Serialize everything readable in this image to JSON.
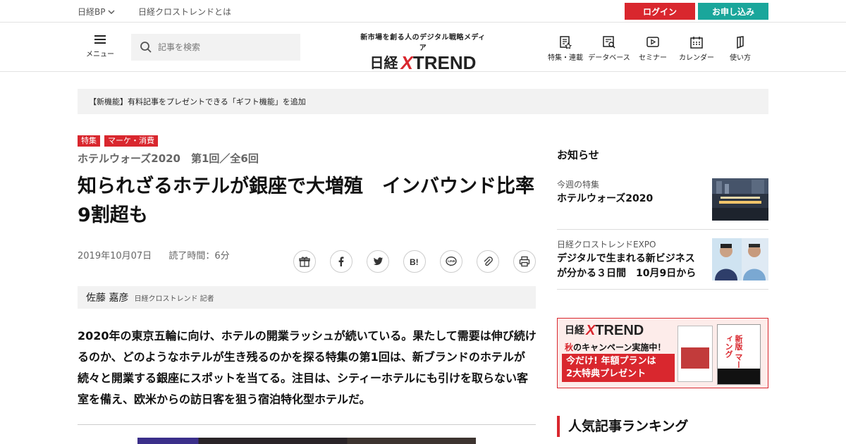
{
  "topbar": {
    "nikkei_bp": "日経BP",
    "about": "日経クロストレンドとは",
    "login": "ログイン",
    "apply": "お申し込み",
    "login_color": "#d9272e",
    "apply_color": "#1aa69b"
  },
  "header": {
    "menu_label": "メニュー",
    "search_placeholder": "記事を検索",
    "logo_tagline": "新市場を創る人のデジタル戦略メディア",
    "logo_nikkei": "日経",
    "logo_x": "X",
    "logo_trend": "TREND",
    "nav": [
      {
        "label": "特集・連載",
        "icon": "feature-icon"
      },
      {
        "label": "データベース",
        "icon": "database-icon"
      },
      {
        "label": "セミナー",
        "icon": "seminar-icon"
      },
      {
        "label": "カレンダー",
        "icon": "calendar-icon"
      },
      {
        "label": "使い方",
        "icon": "guide-icon"
      }
    ]
  },
  "notice": "【新機能】有料記事をプレゼントできる「ギフト機能」を追加",
  "article": {
    "tags": [
      "特集",
      "マーケ・消費"
    ],
    "series": "ホテルウォーズ2020　第1回／全6回",
    "headline": "知られざるホテルが銀座で大増殖　インバウンド比率9割超も",
    "date": "2019年10月07日",
    "read_time": "読了時間：6分",
    "share": [
      "gift",
      "facebook",
      "twitter",
      "hatena",
      "line",
      "link",
      "print"
    ],
    "author_name": "佐藤 嘉彦",
    "author_role": "日経クロストレンド 記者",
    "lead": "2020年の東京五輪に向け、ホテルの開業ラッシュが続いている。果たして需要は伸び続けるのか、どのようなホテルが生き残るのかを探る特集の第1回は、新ブランドのホテルが続々と開業する銀座にスポットを当てる。注目は、シティーホテルにも引けを取らない客室を備え、欧米からの訪日客を狙う宿泊特化型ホテルだ。"
  },
  "sidebar": {
    "heading": "お知らせ",
    "items": [
      {
        "category": "今週の特集",
        "title": "ホテルウォーズ2020"
      },
      {
        "category": "日経クロストレンドEXPO",
        "title": "デジタルで生まれる新ビジネスが分かる３日間　10月9日から"
      }
    ],
    "banner": {
      "nikkei": "日経",
      "x": "X",
      "trend": "TREND",
      "aki": "秋",
      "campaign": "のキャンペーン実施中！",
      "line1": "今だけ! 年額プランは",
      "line2": "2大特典プレゼント",
      "book_title": "新版 マーケティング"
    },
    "ranking_heading": "人気記事ランキング"
  }
}
